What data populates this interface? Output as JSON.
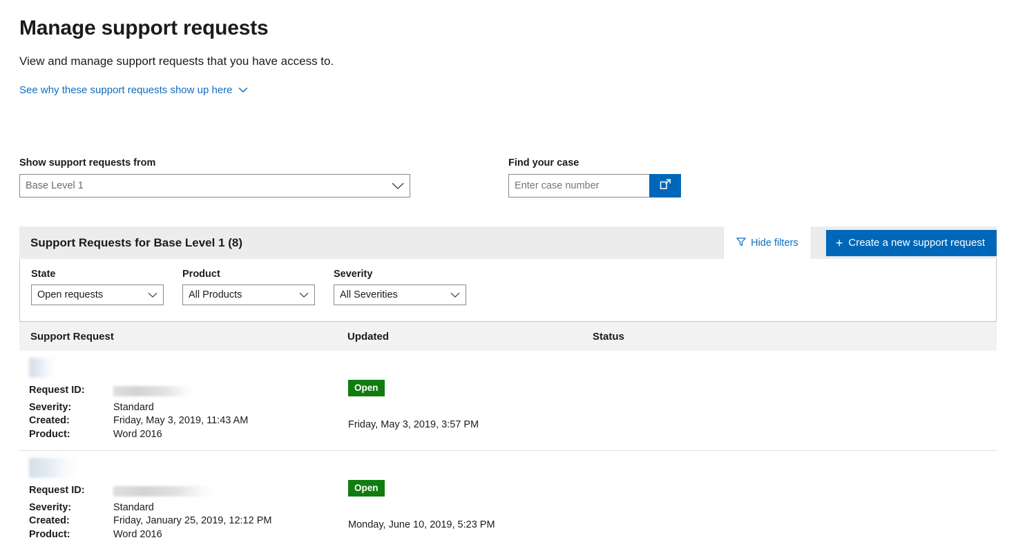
{
  "header": {
    "title": "Manage support requests",
    "subtitle": "View and manage support requests that you have access to.",
    "why_link": "See why these support requests show up here",
    "chevron_icon": "chevron-down-icon"
  },
  "controls": {
    "scope": {
      "label": "Show support requests from",
      "value": "Base Level 1",
      "chevron_icon": "chevron-down-icon"
    },
    "find_case": {
      "label": "Find your case",
      "placeholder": "Enter case number",
      "value": "",
      "button_icon": "open-in-new-window-icon"
    }
  },
  "card": {
    "title": "Support Requests for Base Level 1 (8)",
    "hide_filters_label": "Hide filters",
    "hide_filters_icon": "funnel-filter-icon",
    "create_label": "Create a new support request",
    "create_icon": "plus-icon",
    "filters": [
      {
        "label": "State",
        "value": "Open requests",
        "chevron_icon": "chevron-down-icon"
      },
      {
        "label": "Product",
        "value": "All Products",
        "chevron_icon": "chevron-down-icon"
      },
      {
        "label": "Severity",
        "value": "All Severities",
        "chevron_icon": "chevron-down-icon"
      }
    ],
    "columns": [
      "Support Request",
      "Updated",
      "Status"
    ],
    "rows": [
      {
        "title_redacted": true,
        "fields": [
          {
            "key": "Request ID:",
            "value": "",
            "redacted": true,
            "redacted_width": 118
          },
          {
            "key": "Severity:",
            "value": "Standard",
            "redacted": false
          },
          {
            "key": "Created:",
            "value": "Friday, May 3, 2019, 11:43 AM",
            "redacted": false
          },
          {
            "key": "Product:",
            "value": "Word 2016",
            "redacted": false
          }
        ],
        "updated": "Friday, May 3, 2019, 3:57 PM",
        "status": "Open"
      },
      {
        "title_redacted": true,
        "fields": [
          {
            "key": "Request ID:",
            "value": "",
            "redacted": true,
            "redacted_width": 148
          },
          {
            "key": "Severity:",
            "value": "Standard",
            "redacted": false
          },
          {
            "key": "Created:",
            "value": "Friday, January 25, 2019, 12:12 PM",
            "redacted": false
          },
          {
            "key": "Product:",
            "value": "Word 2016",
            "redacted": false
          }
        ],
        "updated": "Monday, June 10, 2019, 5:23 PM",
        "status": "Open"
      }
    ]
  },
  "colors": {
    "accent_blue": "#0067b8",
    "link_blue": "#0f6cbd",
    "status_green": "#107c10",
    "header_gray": "#ececec",
    "column_gray": "#f2f2f2"
  }
}
